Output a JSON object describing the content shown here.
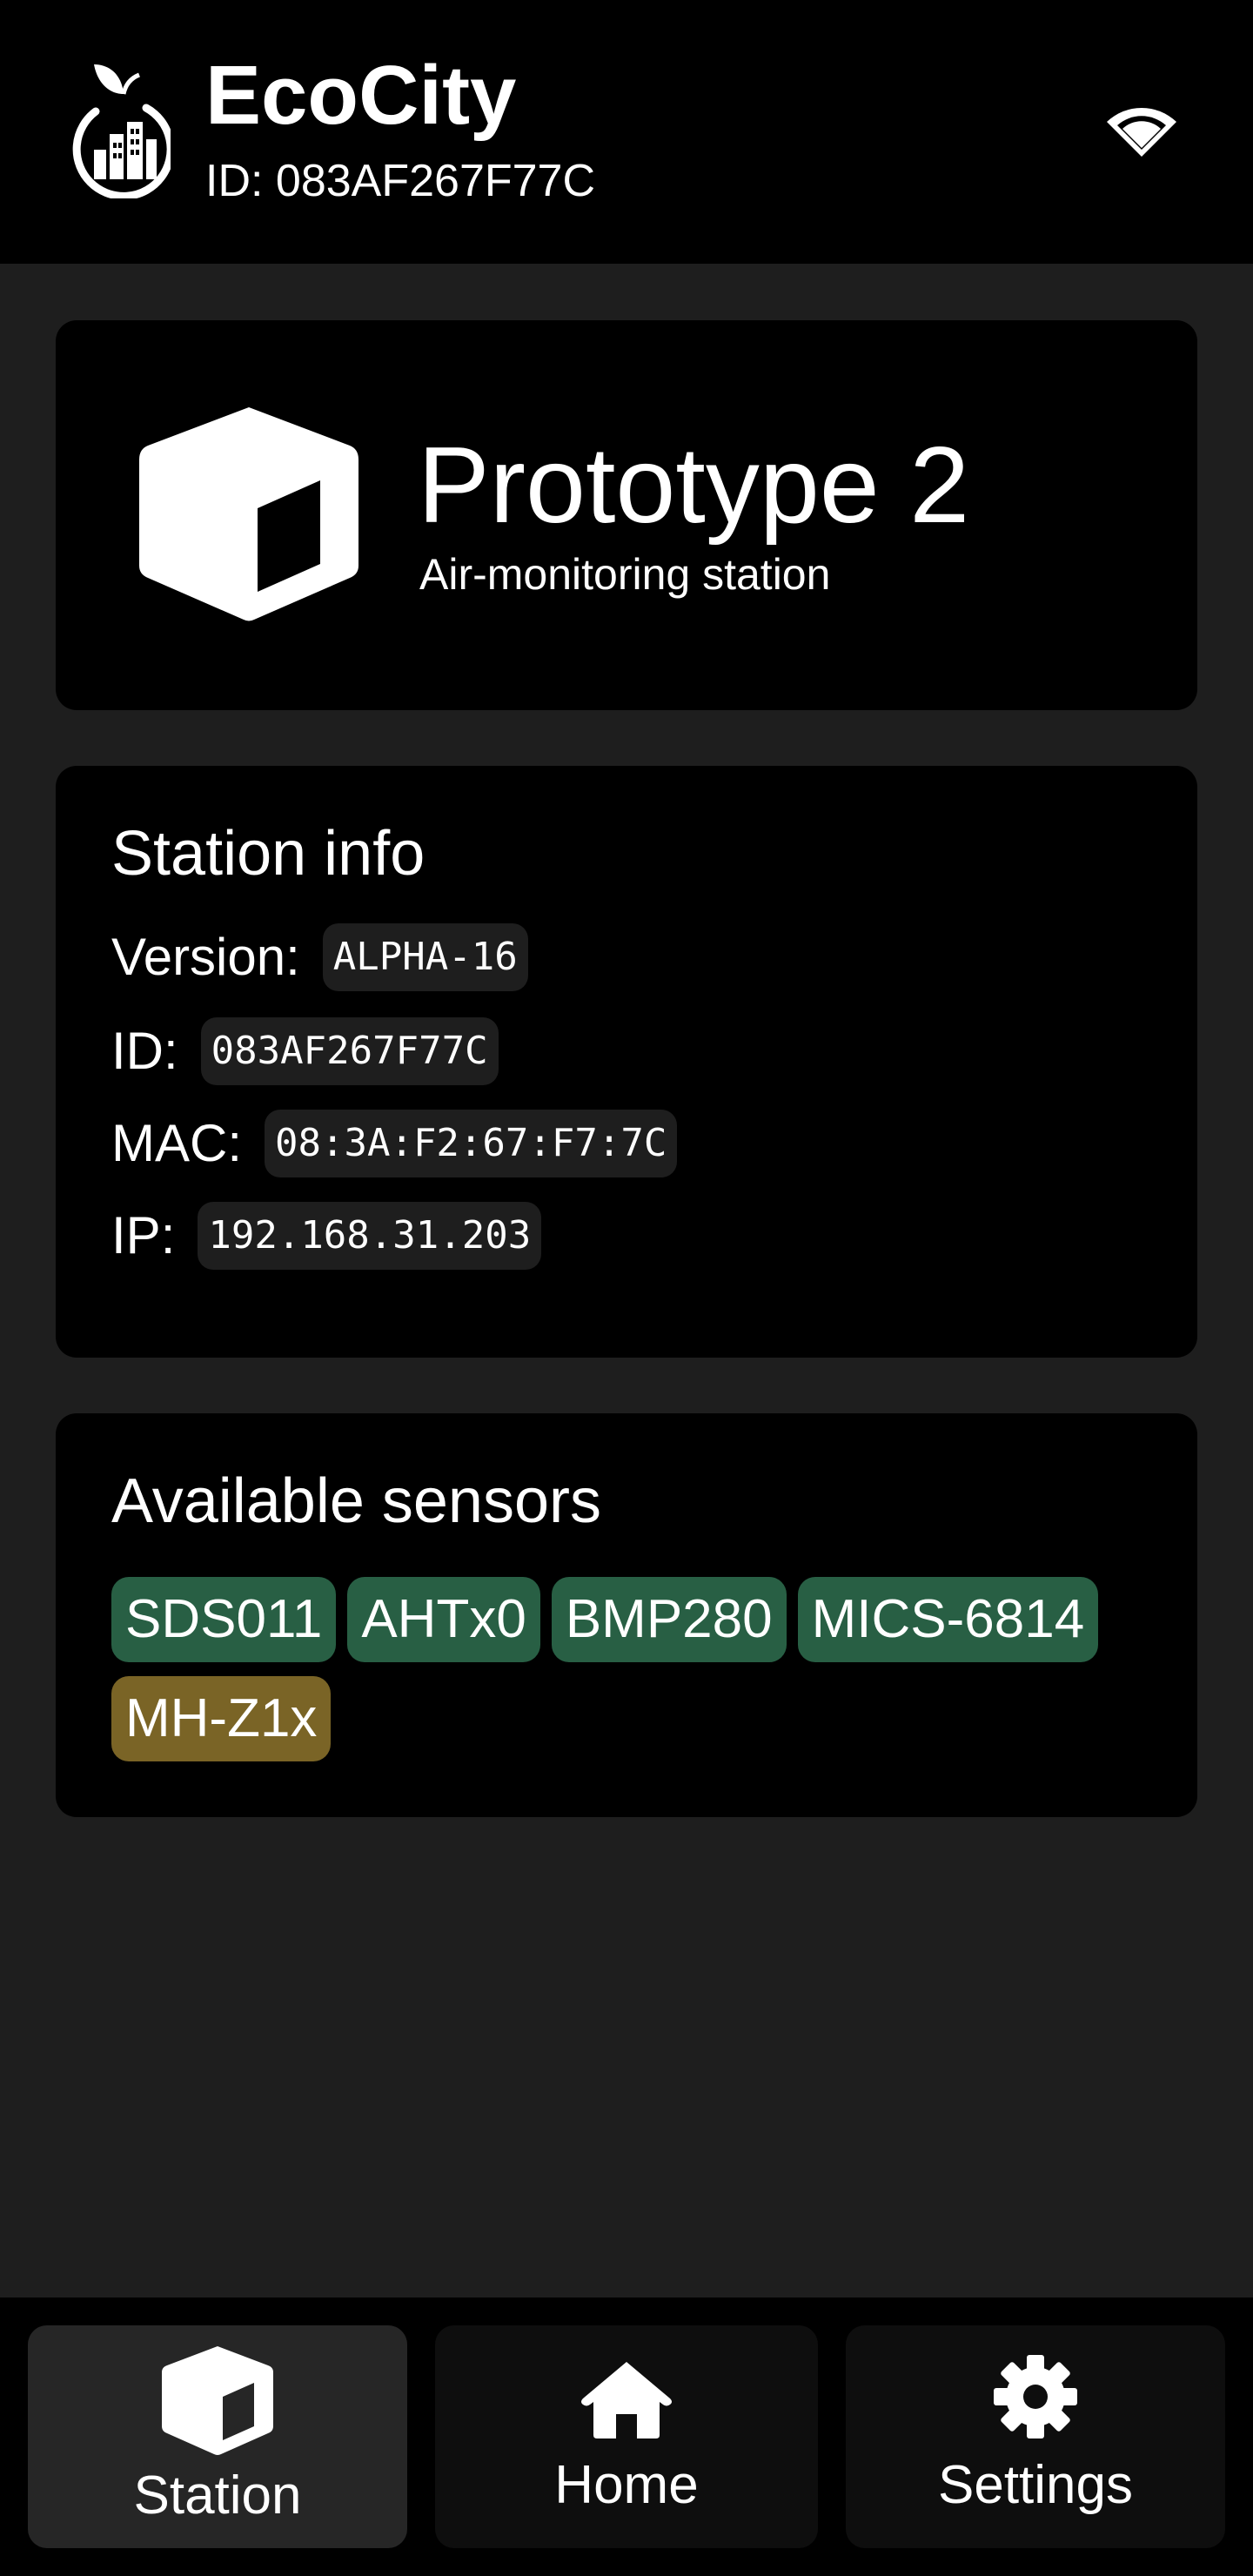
{
  "header": {
    "app_name": "EcoCity",
    "device_id": "ID: 083AF267F77C",
    "logo_icon": "city-leaf-logo",
    "status_icon": "wifi-icon"
  },
  "device_card": {
    "icon": "cube-icon",
    "title": "Prototype 2",
    "subtitle": "Air-monitoring station"
  },
  "station_info": {
    "title": "Station info",
    "rows": [
      {
        "label": "Version:",
        "value": "ALPHA-16"
      },
      {
        "label": "ID:",
        "value": "083AF267F77C"
      },
      {
        "label": "MAC:",
        "value": "08:3A:F2:67:F7:7C"
      },
      {
        "label": "IP:",
        "value": "192.168.31.203"
      }
    ]
  },
  "sensors": {
    "title": "Available sensors",
    "items": [
      {
        "label": "SDS011",
        "status": "available"
      },
      {
        "label": "AHTx0",
        "status": "available"
      },
      {
        "label": "BMP280",
        "status": "available"
      },
      {
        "label": "MICS-6814",
        "status": "available"
      },
      {
        "label": "MH-Z1x",
        "status": "warning"
      }
    ],
    "colors": {
      "available": "#285f44",
      "warning": "#7a6426"
    }
  },
  "nav": {
    "items": [
      {
        "label": "Station",
        "icon": "cube-icon",
        "active": true
      },
      {
        "label": "Home",
        "icon": "home-icon",
        "active": false
      },
      {
        "label": "Settings",
        "icon": "gear-icon",
        "active": false
      }
    ]
  },
  "colors": {
    "background": "#1e1e1e",
    "surface": "#000000",
    "text": "#ffffff"
  }
}
